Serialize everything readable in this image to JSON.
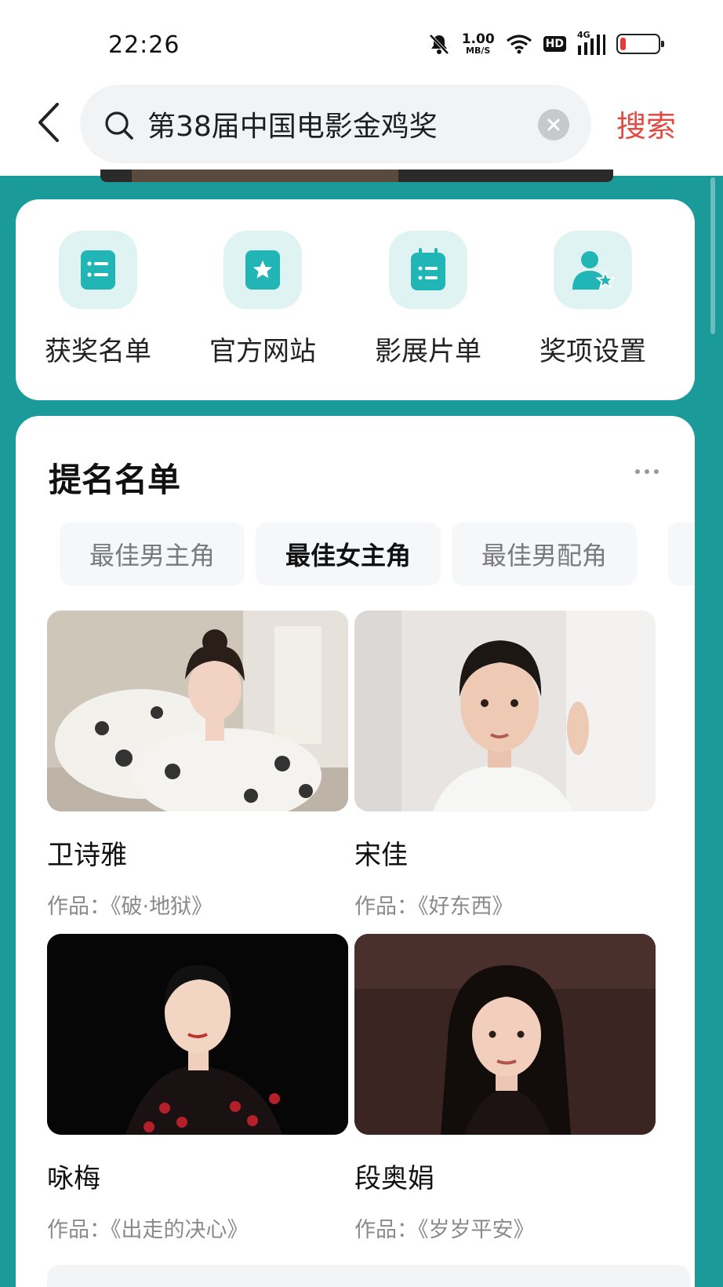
{
  "status_bar": {
    "time": "22:26",
    "net_speed_value": "1.00",
    "net_speed_unit": "MB/S",
    "hd_badge": "HD",
    "network_type": "4G",
    "battery_level": 0.15,
    "battery_color": "#e23b3b"
  },
  "search": {
    "query": "第38届中国电影金鸡奖",
    "submit_label": "搜索"
  },
  "quick_actions": [
    {
      "label": "获奖名单",
      "icon": "list-icon"
    },
    {
      "label": "官方网站",
      "icon": "star-page-icon"
    },
    {
      "label": "影展片单",
      "icon": "calendar-list-icon"
    },
    {
      "label": "奖项设置",
      "icon": "user-star-icon"
    }
  ],
  "nomination": {
    "title": "提名名单",
    "tabs": [
      {
        "label": "最佳男主角",
        "active": false
      },
      {
        "label": "最佳女主角",
        "active": true
      },
      {
        "label": "最佳男配角",
        "active": false
      }
    ],
    "nominees": [
      {
        "name": "卫诗雅",
        "work": "作品：《破·地狱》"
      },
      {
        "name": "宋佳",
        "work": "作品：《好东西》"
      },
      {
        "name": "咏梅",
        "work": "作品：《出走的决心》"
      },
      {
        "name": "段奥娟",
        "work": "作品：《岁岁平安》"
      }
    ]
  },
  "colors": {
    "background_teal": "#1a9b9a",
    "accent_red": "#e24b43",
    "icon_teal": "#21b5b6"
  }
}
